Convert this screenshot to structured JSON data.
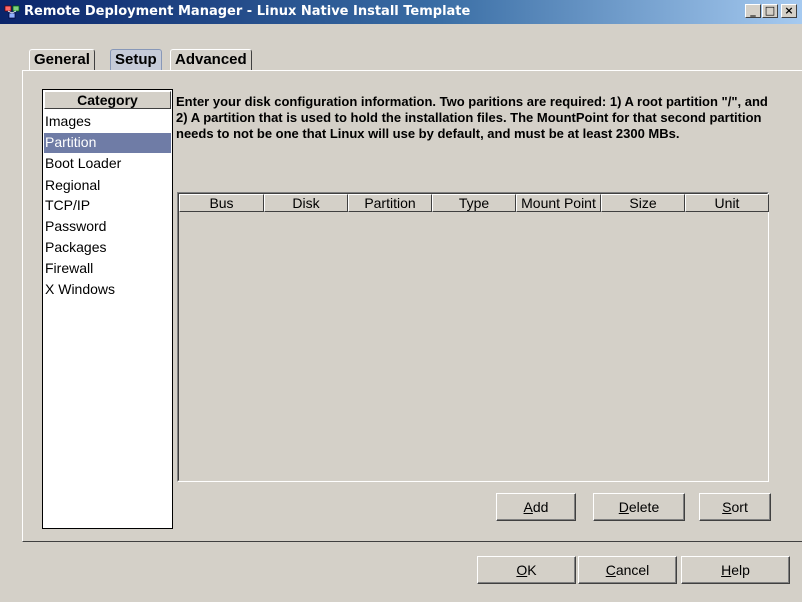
{
  "window": {
    "title": "Remote Deployment Manager - Linux Native Install Template",
    "minimize_glyph": "_",
    "maximize_glyph": "□",
    "close_glyph": "×"
  },
  "tabs": [
    {
      "label": "General",
      "selected": false
    },
    {
      "label": "Setup",
      "selected": true
    },
    {
      "label": "Advanced",
      "selected": false
    }
  ],
  "category": {
    "header": "Category",
    "items": [
      {
        "label": "Images",
        "selected": false
      },
      {
        "label": "Partition",
        "selected": true
      },
      {
        "label": "Boot Loader",
        "selected": false
      },
      {
        "label": "Regional",
        "selected": false
      },
      {
        "label": "TCP/IP",
        "selected": false
      },
      {
        "label": "Password",
        "selected": false
      },
      {
        "label": "Packages",
        "selected": false
      },
      {
        "label": "Firewall",
        "selected": false
      },
      {
        "label": "X Windows",
        "selected": false
      }
    ]
  },
  "description": "Enter your disk configuration information.  Two paritions are required:  1) A root partition \"/\", and 2) A partition that is used to hold the installation files.  The MountPoint for that second partition needs to not be one that Linux will use by default, and must be at least 2300 MBs.",
  "table": {
    "columns": [
      "Bus",
      "Disk",
      "Partition",
      "Type",
      "Mount Point",
      "Size",
      "Unit"
    ],
    "rows": []
  },
  "table_buttons": {
    "add": {
      "mnemonic": "A",
      "rest": "dd"
    },
    "delete": {
      "mnemonic": "D",
      "rest": "elete"
    },
    "sort": {
      "mnemonic": "S",
      "rest": "ort"
    }
  },
  "dialog_buttons": {
    "ok": {
      "mnemonic": "O",
      "rest": "K"
    },
    "cancel": {
      "mnemonic": "C",
      "rest": "ancel"
    },
    "help": {
      "mnemonic": "H",
      "rest": "elp"
    }
  },
  "colors": {
    "title_gradient_start": "#0a246a",
    "title_gradient_end": "#a6caf0",
    "face": "#d4d0c8",
    "selection": "#6f7ca6",
    "selected_tab": "#c6cbd8"
  }
}
